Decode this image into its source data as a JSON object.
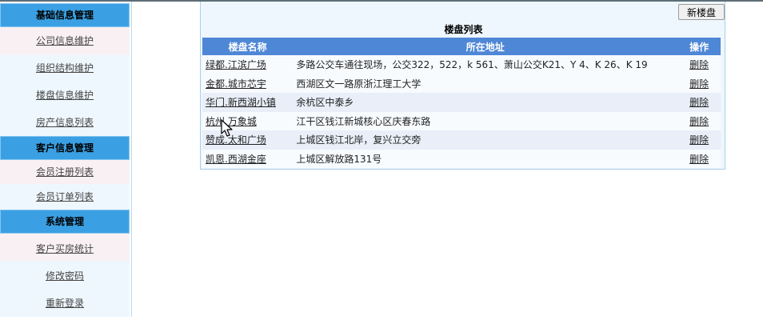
{
  "sidebar": {
    "sections": [
      {
        "title": "基础信息管理",
        "items": [
          "公司信息维护",
          "组织结构维护",
          "楼盘信息维护",
          "房产信息列表"
        ]
      },
      {
        "title": "客户信息管理",
        "items": [
          "会员注册列表",
          "会员订单列表"
        ]
      },
      {
        "title": "系统管理",
        "items": [
          "客户买房统计",
          "修改密码",
          "重新登录"
        ]
      }
    ]
  },
  "main": {
    "new_button": "新楼盘",
    "title": "楼盘列表",
    "columns": [
      "楼盘名称",
      "所在地址",
      "操作"
    ],
    "rows": [
      {
        "name": "绿都.江滨广场",
        "address": "多路公交车通往现场，公交322，522，k 561、萧山公交K21、Y 4、K 26、K 19",
        "action": "删除"
      },
      {
        "name": "金都.城市芯宇",
        "address": "西湖区文一路原浙江理工大学",
        "action": "删除"
      },
      {
        "name": "华门.新西湖小镇",
        "address": "余杭区中泰乡",
        "action": "删除"
      },
      {
        "name": "杭州.万象城",
        "address": "江干区钱江新城核心区庆春东路",
        "action": "删除"
      },
      {
        "name": "赞成.太和广场",
        "address": "上城区钱江北岸，复兴立交旁",
        "action": "删除"
      },
      {
        "name": "凯恩.西湖金座",
        "address": "上城区解放路131号",
        "action": "删除"
      }
    ]
  }
}
